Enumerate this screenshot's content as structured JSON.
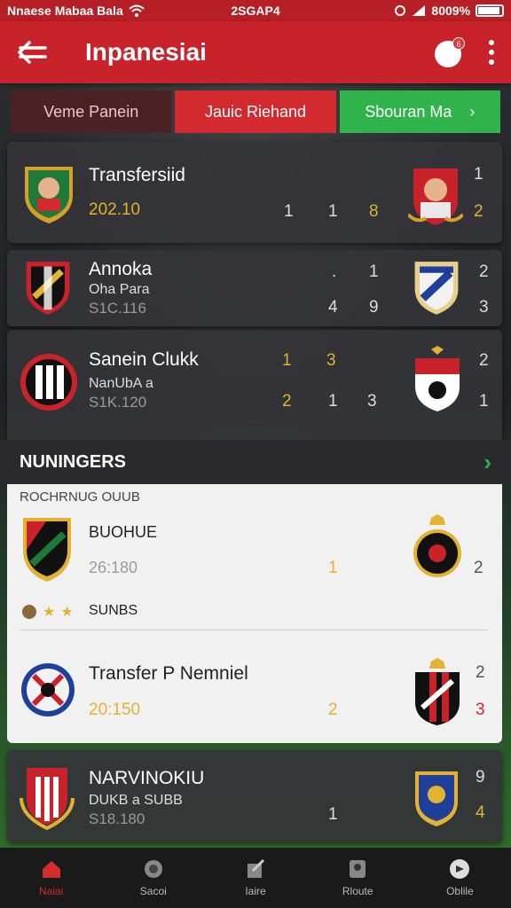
{
  "status_bar": {
    "carrier": "Nnaese Mabaa Bala",
    "time": "2SGAP4",
    "battery": "8009%"
  },
  "app_bar": {
    "title": "Inpanesiai",
    "notification_count": "6"
  },
  "tabs": [
    {
      "label": "Veme Panein"
    },
    {
      "label": "Jauic Riehand"
    },
    {
      "label": "Sbouran Ma"
    }
  ],
  "cards": [
    {
      "title": "Transfersiid",
      "subtitle": "",
      "date": "202.10",
      "nums_top": [
        "1"
      ],
      "nums_bottom": [
        "1",
        "1",
        "8",
        "2"
      ]
    },
    {
      "title": "Annoka",
      "subtitle": "Oha Para",
      "date": "S1C.116",
      "nums_top": [
        ".",
        "1",
        "2"
      ],
      "nums_bottom": [
        "4",
        "9",
        "3"
      ]
    },
    {
      "title": "Sanein Clukk",
      "subtitle": "NanUbA a",
      "date": "S1K.120",
      "nums_top": [
        "1",
        "3",
        "2"
      ],
      "nums_bottom": [
        "2",
        "1",
        "3",
        "1"
      ]
    }
  ],
  "section": {
    "title": "NUNINGERS"
  },
  "panel": {
    "header": "ROCHRNUG OUUB",
    "row1": {
      "title": "BUOHUE",
      "date": "26:180",
      "num_mid": "1",
      "num_right": "2",
      "rating_label": "SUNBS"
    },
    "row2": {
      "title": "Transfer P Nemniel",
      "date": "20:150",
      "num_mid": "2",
      "num_right_top": "2",
      "num_right_bottom": "3"
    }
  },
  "bottom_card": {
    "title": "NARVINOKIU",
    "subtitle": "DUKB a SUBB",
    "date": "S18.180",
    "num_mid": "1",
    "num_right_top": "9",
    "num_right_bottom": "4"
  },
  "nav": [
    {
      "label": "Naiai",
      "icon": "home-icon"
    },
    {
      "label": "Sacoi",
      "icon": "globe-icon"
    },
    {
      "label": "Iaire",
      "icon": "edit-icon"
    },
    {
      "label": "Rloute",
      "icon": "team-icon"
    },
    {
      "label": "Oblile",
      "icon": "profile-icon"
    }
  ],
  "colors": {
    "accent_red": "#c8232b",
    "accent_green": "#2fb34a",
    "gold": "#e2b233"
  }
}
